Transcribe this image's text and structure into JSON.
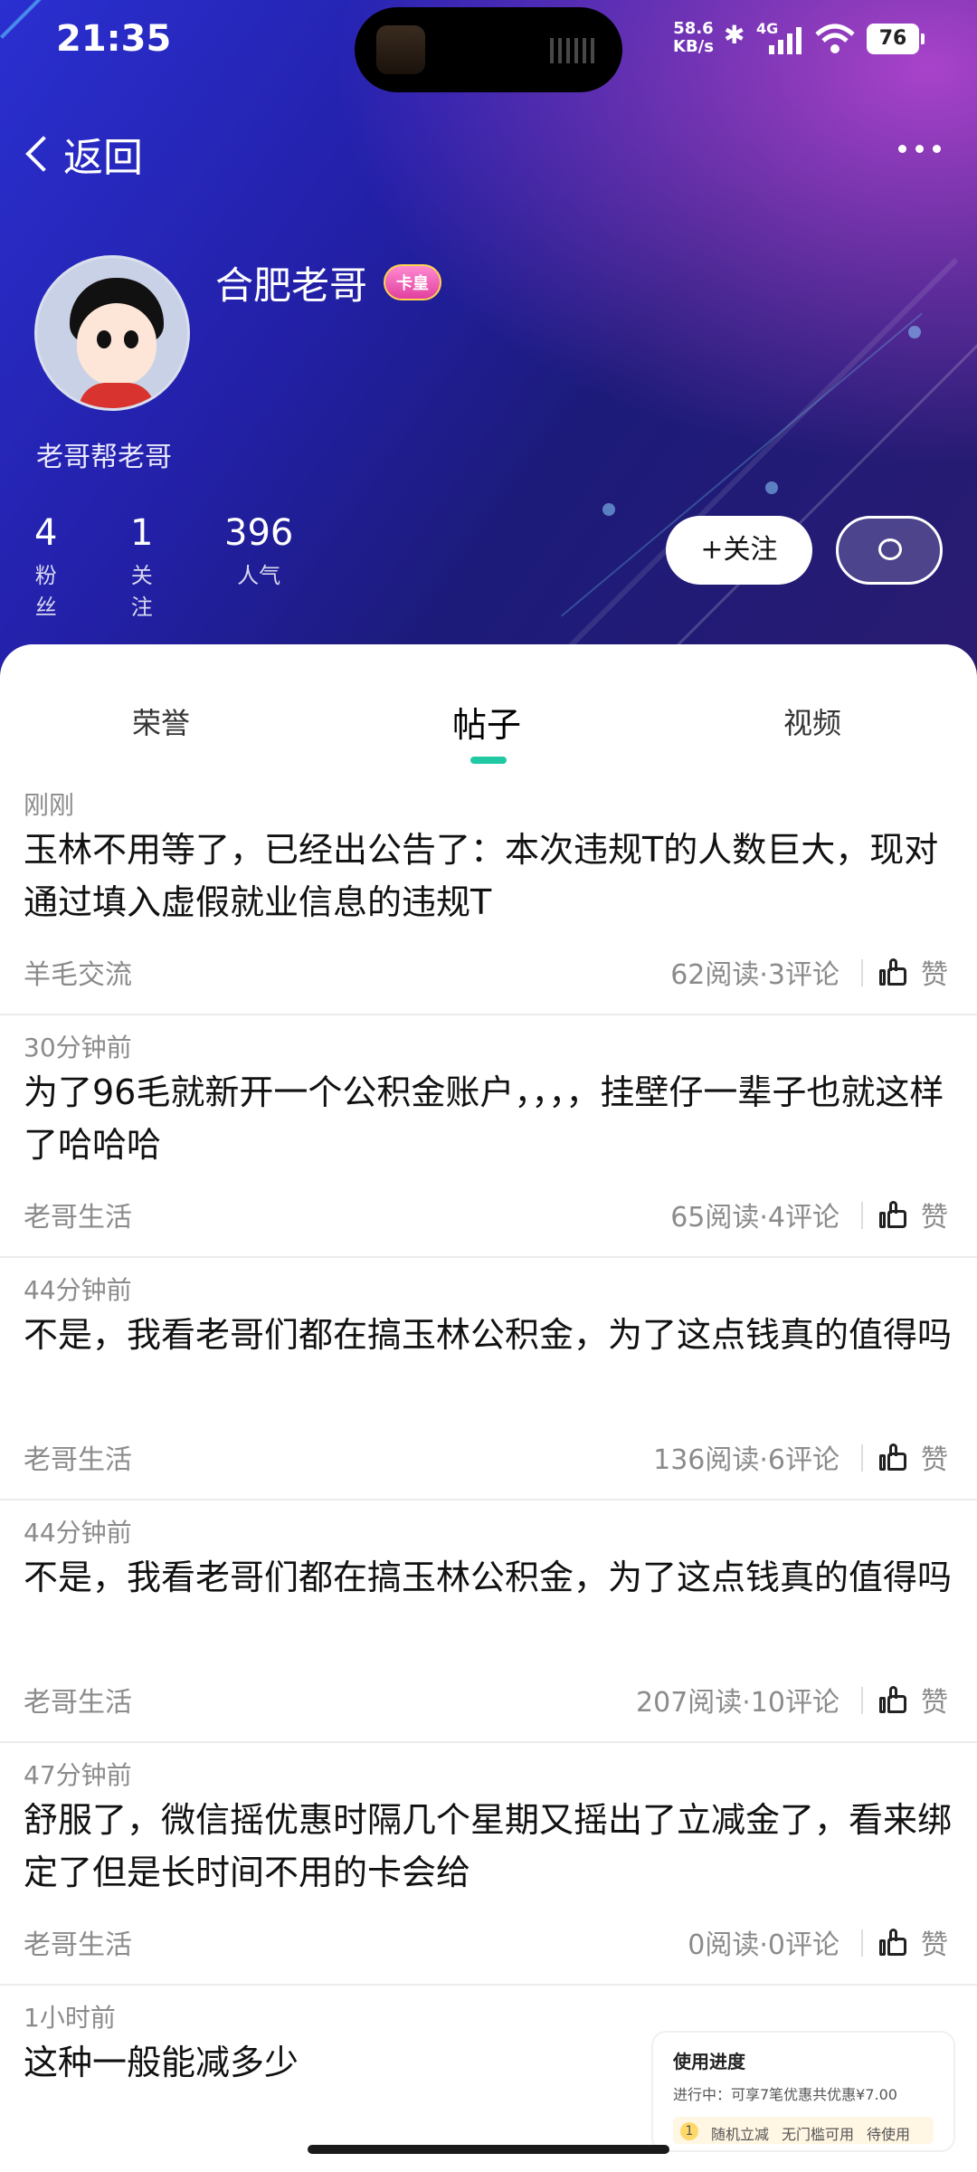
{
  "status_bar": {
    "time": "21:35",
    "net_speed_value": "58.6",
    "net_speed_unit": "KB/s",
    "network": "4G",
    "battery": "76"
  },
  "nav": {
    "back_label": "返回"
  },
  "profile": {
    "username": "合肥老哥",
    "badge": "卡皇",
    "signature": "老哥帮老哥",
    "stats": [
      {
        "value": "4",
        "label": "粉丝"
      },
      {
        "value": "1",
        "label": "关注"
      },
      {
        "value": "396",
        "label": "人气"
      }
    ],
    "follow_label": "+关注"
  },
  "tabs": [
    {
      "label": "荣誉"
    },
    {
      "label": "帖子",
      "active": true
    },
    {
      "label": "视频"
    }
  ],
  "posts": [
    {
      "time": "刚刚",
      "title": "玉林不用等了，已经出公告了：本次违规T的人数巨大，现对通过填入虚假就业信息的违规T",
      "category": "羊毛交流",
      "stats": "62阅读·3评论",
      "like": "赞"
    },
    {
      "time": "30分钟前",
      "title": "为了96毛就新开一个公积金账户，，，，挂壁仔一辈子也就这样了哈哈哈",
      "category": "老哥生活",
      "stats": "65阅读·4评论",
      "like": "赞"
    },
    {
      "time": "44分钟前",
      "title": "不是，我看老哥们都在搞玉林公积金，为了这点钱真的值得吗",
      "category": "老哥生活",
      "stats": "136阅读·6评论",
      "like": "赞"
    },
    {
      "time": "44分钟前",
      "title": "不是，我看老哥们都在搞玉林公积金，为了这点钱真的值得吗",
      "category": "老哥生活",
      "stats": "207阅读·10评论",
      "like": "赞"
    },
    {
      "time": "47分钟前",
      "title": "舒服了，微信摇优惠时隔几个星期又摇出了立减金了，看来绑定了但是长时间不用的卡会给",
      "category": "老哥生活",
      "stats": "0阅读·0评论",
      "like": "赞"
    },
    {
      "time": "1小时前",
      "title": "这种一般能减多少",
      "preview": {
        "title": "使用进度",
        "subtitle": "进行中：可享7笔优惠共优惠¥7.00",
        "row_num": "1",
        "row_a": "随机立减",
        "row_b": "无门槛可用",
        "row_c": "待使用"
      }
    }
  ]
}
